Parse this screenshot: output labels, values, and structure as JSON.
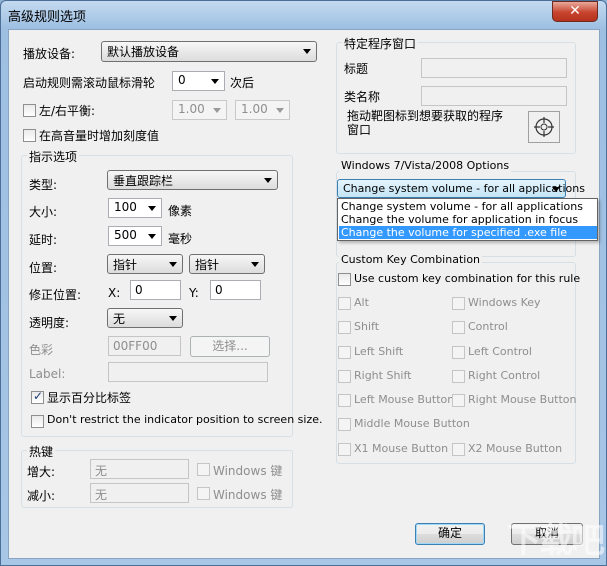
{
  "window": {
    "title": "高级规则选项",
    "close_glyph": "✕"
  },
  "left": {
    "playback_device_label": "播放设备:",
    "playback_device_value": "默认播放设备",
    "scroll_label": "启动规则需滚动鼠标滑轮",
    "scroll_value": "0",
    "scroll_suffix": "次后",
    "balance_label": "左/右平衡:",
    "balance_left_value": "1.00",
    "balance_right_value": "1.00",
    "high_volume_label": "在高音量时增加刻度值",
    "indicator_group_title": "指示选项",
    "type_label": "类型:",
    "type_value": "垂直跟踪栏",
    "size_label": "大小:",
    "size_value": "100",
    "size_unit": "像素",
    "delay_label": "延时:",
    "delay_value": "500",
    "delay_unit": "毫秒",
    "position_label": "位置:",
    "position_value_1": "指针",
    "position_value_2": "指针",
    "offset_label": "修正位置:",
    "x_label": "X:",
    "x_value": "0",
    "y_label": "Y:",
    "y_value": "0",
    "transparency_label": "透明度:",
    "transparency_value": "无",
    "color_label": "色彩",
    "color_value": "00FF00",
    "color_button": "选择...",
    "label_label": "Label:",
    "label_value": "",
    "show_percent_label": "显示百分比标签",
    "no_restrict_label": "Don't restrict the indicator position to screen size.",
    "hotkey_group_title": "热键",
    "increase_label": "增大:",
    "increase_value": "无",
    "decrease_label": "减小:",
    "decrease_value": "无",
    "windows_key_1": "Windows 键",
    "windows_key_2": "Windows 键"
  },
  "right": {
    "specific_window_title": "特定程序窗口",
    "title_label": "标题",
    "class_label": "类名称",
    "drag_hint": "拖动靶图标到想要获取的程序窗口",
    "os_options_title": "Windows 7/Vista/2008 Options",
    "os_selected": "Change system volume - for all applications",
    "os_options": [
      "Change system volume - for all applications",
      "Change the volume for application in focus",
      "Change the volume for specified .exe file"
    ],
    "custom_key_title": "Custom Key Combination",
    "use_custom_label": "Use custom key combination for this rule",
    "keys": {
      "alt": "Alt",
      "windows_key": "Windows Key",
      "shift": "Shift",
      "control": "Control",
      "left_shift": "Left Shift",
      "left_control": "Left Control",
      "right_shift": "Right Shift",
      "right_control": "Right Control",
      "left_mouse": "Left Mouse Button",
      "right_mouse": "Right Mouse Button",
      "middle_mouse": "Middle Mouse Button",
      "x1_mouse": "X1 Mouse Button",
      "x2_mouse": "X2 Mouse Button"
    }
  },
  "footer": {
    "ok_label": "确定",
    "cancel_label": "取消"
  },
  "watermark": "下载吧"
}
